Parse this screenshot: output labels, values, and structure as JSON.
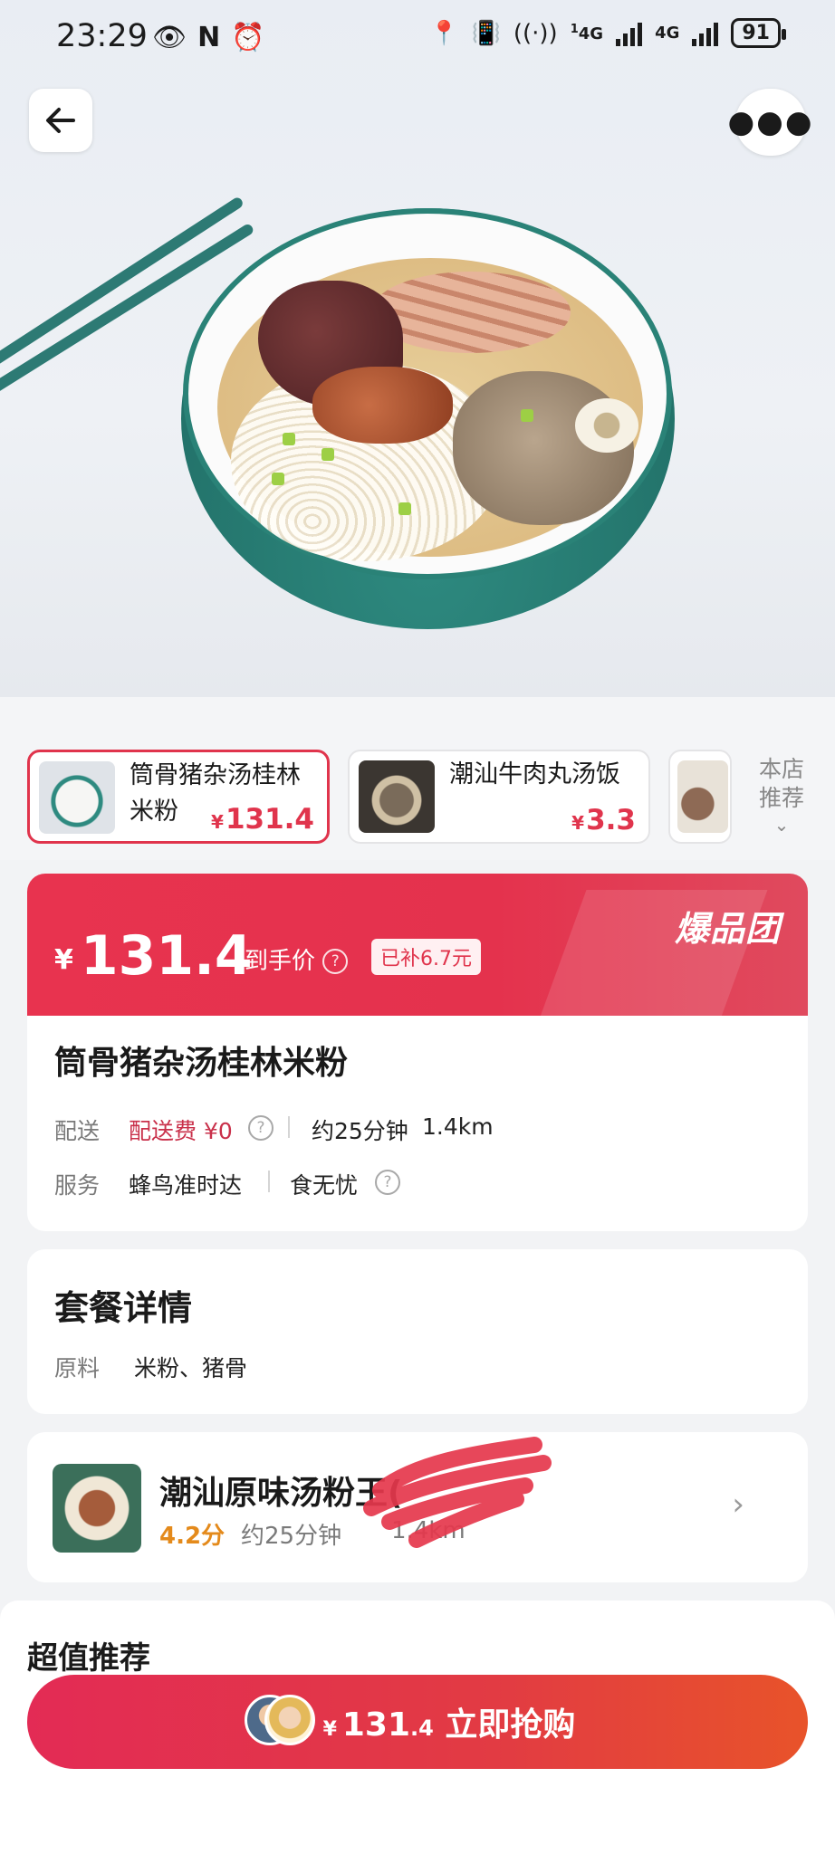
{
  "status_bar": {
    "time": "23:29",
    "network_1": "4G",
    "network_2": "4G",
    "signal_sup": "1",
    "battery": "91"
  },
  "header": {
    "back_icon": "arrow-left-icon",
    "more_icon": "more-icon"
  },
  "products": [
    {
      "name": "筒骨猪杂汤桂林米粉",
      "currency": "¥",
      "price": "131.4",
      "active": true
    },
    {
      "name": "潮汕牛肉丸汤饭",
      "currency": "¥",
      "price": "3.3",
      "active": false
    }
  ],
  "store_recommend": {
    "label": "本店推荐"
  },
  "price_card": {
    "currency": "¥",
    "price": "131.4",
    "price_label": "到手价",
    "subsidy": "已补6.7元",
    "brand": "爆品团"
  },
  "dish": {
    "title": "筒骨猪杂汤桂林米粉",
    "delivery_label": "配送",
    "delivery_fee": "配送费 ¥0",
    "delivery_time": "约25分钟",
    "delivery_distance": "1.4km",
    "service_label": "服务",
    "service_1": "蜂鸟准时达",
    "service_2": "食无忧"
  },
  "combo": {
    "title": "套餐详情",
    "ingredients_label": "原料",
    "ingredients": "米粉、猪骨"
  },
  "shop": {
    "name": "潮汕原味汤粉王(",
    "rating": "4.2分",
    "time": "约25分钟",
    "distance": "1.4km"
  },
  "recommend": {
    "title": "超值推荐"
  },
  "buy_bar": {
    "currency": "¥",
    "price_int": "131",
    "price_dec": ".4",
    "action": "立即抢购"
  },
  "colors": {
    "accent_red": "#e0344c",
    "rating_orange": "#e48a1b"
  }
}
